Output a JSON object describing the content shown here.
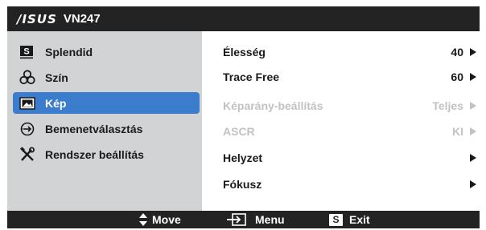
{
  "osd": {
    "brand": "/ISUS",
    "model": "VN247"
  },
  "sidebar": {
    "items": [
      {
        "label": "Splendid",
        "icon": "splendid-s-icon"
      },
      {
        "label": "Szín",
        "icon": "color-circles-icon"
      },
      {
        "label": "Kép",
        "icon": "picture-icon",
        "active": true
      },
      {
        "label": "Bemenetválasztás",
        "icon": "input-select-icon"
      },
      {
        "label": "Rendszer beállítás",
        "icon": "tools-icon"
      }
    ]
  },
  "main": {
    "rows": [
      {
        "label": "Élesség",
        "value": "40",
        "enabled": true
      },
      {
        "label": "Trace Free",
        "value": "60",
        "enabled": true
      },
      {
        "label": "Képarány-beállítás",
        "value": "Teljes",
        "enabled": false
      },
      {
        "label": "ASCR",
        "value": "KI",
        "enabled": false
      },
      {
        "label": "Helyzet",
        "value": "",
        "enabled": true
      },
      {
        "label": "Fókusz",
        "value": "",
        "enabled": true
      }
    ]
  },
  "bottom": {
    "move_label": "Move",
    "menu_label": "Menu",
    "exit_key": "S",
    "exit_label": "Exit"
  },
  "colors": {
    "bar": "#232323",
    "sidebar_bg": "#d2d3d5",
    "active": "#3b7ccd",
    "disabled_text": "#c1c2c4"
  }
}
